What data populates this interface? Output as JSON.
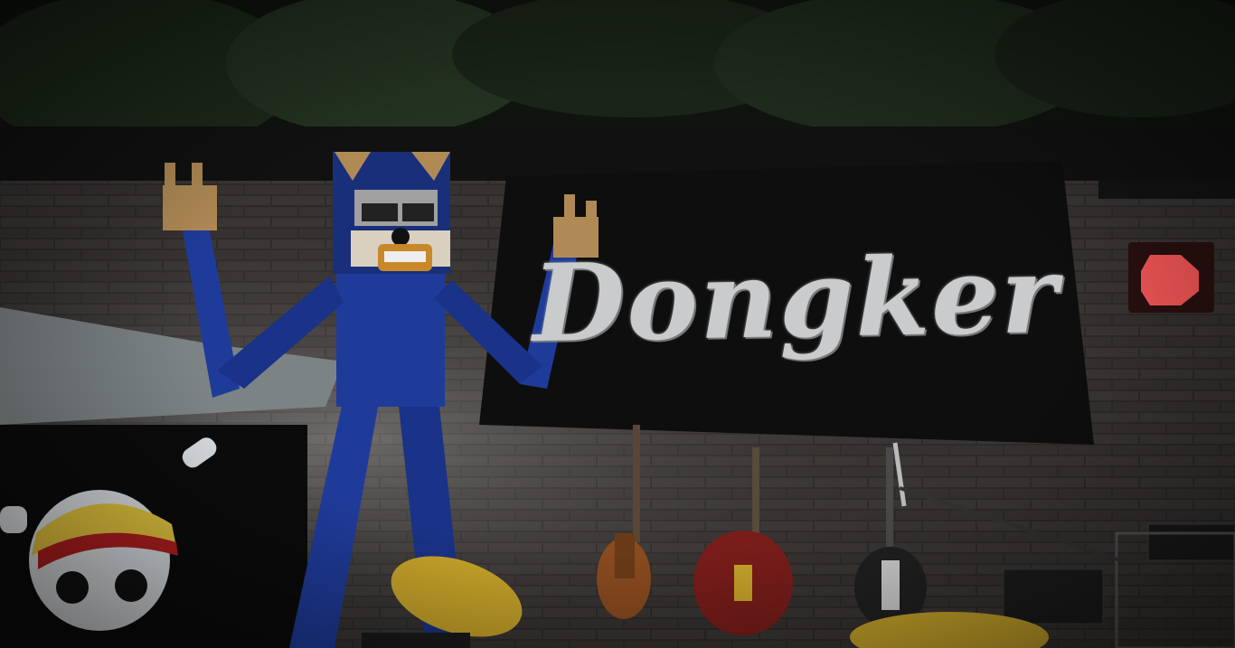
{
  "scene": {
    "banner": {
      "text": "Dongker"
    },
    "icons": [
      "tree-foliage",
      "brick-wall",
      "band-banner",
      "stage-light",
      "blue-cat-character",
      "pirate-flag",
      "cymbal",
      "bass-guitar",
      "hollow-body-guitar",
      "electric-guitar",
      "amplifier",
      "microphone-stand"
    ],
    "colors": {
      "background": "#0c0c0c",
      "wall": "#2e2b2a",
      "character_body": "#1f3b9a",
      "banner_cloth": "#0e0e0f",
      "banner_text": "#c9cbcc",
      "stage_light": "#ff5a5a",
      "cymbal": "#c9a52a"
    }
  }
}
